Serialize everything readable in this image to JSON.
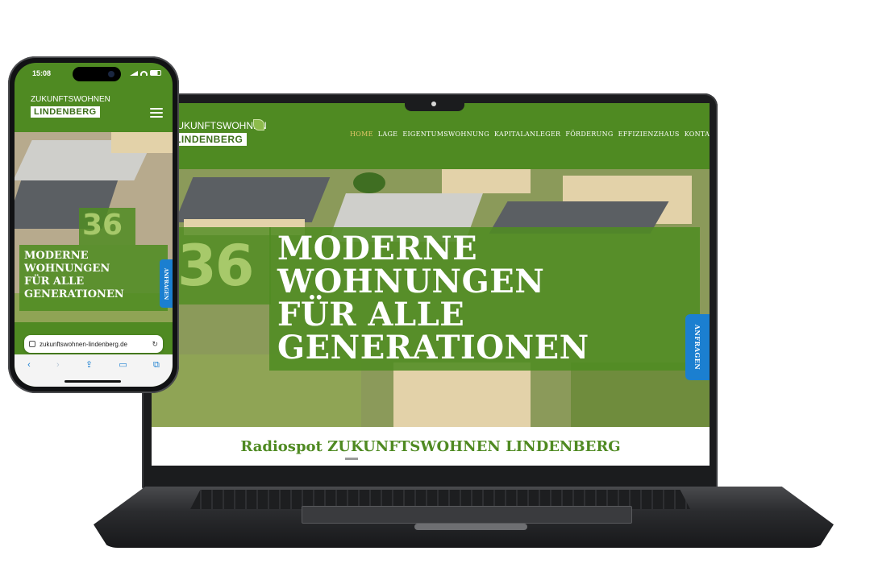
{
  "laptop": {
    "logo": {
      "top": "ZUKUNFTSWOHNEN",
      "bottom": "LINDENBERG"
    },
    "nav": [
      {
        "label": "HOME",
        "active": true
      },
      {
        "label": "LAGE",
        "active": false
      },
      {
        "label": "EIGENTUMSWOHNUNG",
        "active": false
      },
      {
        "label": "KAPITALANLEGER",
        "active": false
      },
      {
        "label": "FÖRDERUNG",
        "active": false
      },
      {
        "label": "EFFIZIENZHAUS",
        "active": false
      },
      {
        "label": "KONTAKT",
        "active": false
      }
    ],
    "hero": {
      "number": "36",
      "headline": [
        "MODERNE",
        "WOHNUNGEN",
        "FÜR ALLE",
        "GENERATIONEN"
      ]
    },
    "cta": "ANFRAGEN",
    "section_title": "Radiospot ZUKUNFTSWOHNEN LINDENBERG"
  },
  "phone": {
    "status_time": "15:08",
    "logo": {
      "top": "ZUKUNFTSWOHNEN",
      "bottom": "LINDENBERG"
    },
    "hero": {
      "number": "36",
      "headline": [
        "MODERNE",
        "WOHNUNGEN",
        "FÜR ALLE",
        "GENERATIONEN"
      ]
    },
    "cta": "ANFRAGEN",
    "url": "zukunftswohnen-lindenberg.de",
    "toolbar": [
      "back-icon",
      "forward-icon",
      "share-icon",
      "bookmarks-icon",
      "tabs-icon"
    ]
  },
  "colors": {
    "brand_green": "#4f8a22",
    "light_green_number": "#a7c96a",
    "cta_blue": "#1b7fd0",
    "active_nav_gold": "#e6c86a"
  }
}
